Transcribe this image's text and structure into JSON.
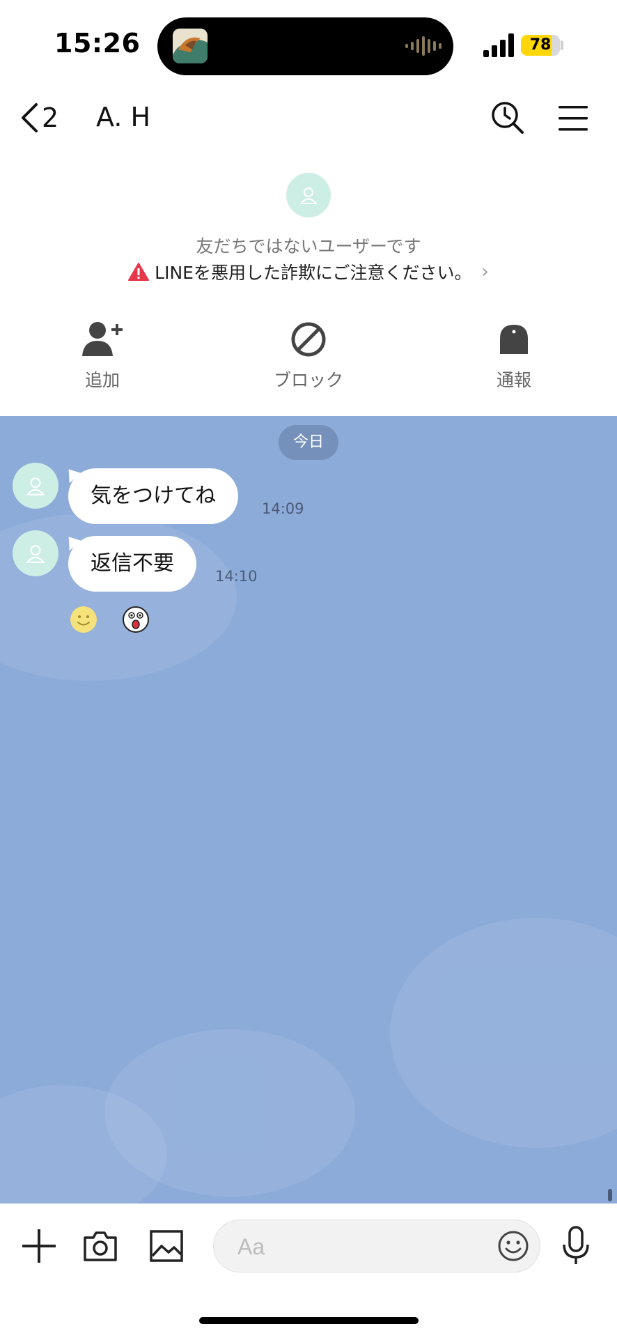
{
  "status_bar": {
    "time": "15:26",
    "battery_percent": "78",
    "battery_level": 0.78,
    "battery_color": "#ffd60a"
  },
  "header": {
    "back_count": "2",
    "title": "A. H",
    "icons": [
      "chevron-left-icon",
      "search-history-icon",
      "hamburger-menu-icon"
    ]
  },
  "profile_notice": {
    "not_friend_text": "友だちではないユーザーです",
    "warning_text": "LINEを悪用した詐欺にご注意ください。",
    "warning_color": "#e5384a"
  },
  "actions": [
    {
      "label": "追加",
      "icon": "add-friend-icon"
    },
    {
      "label": "ブロック",
      "icon": "block-icon"
    },
    {
      "label": "通報",
      "icon": "report-icon"
    }
  ],
  "chat": {
    "background_color": "#8cabd9",
    "date_label": "今日",
    "messages": [
      {
        "text": "気をつけてね",
        "time": "14:09"
      },
      {
        "text": "返信不要",
        "time": "14:10"
      }
    ],
    "reactions": [
      "smile-reaction-icon",
      "surprised-reaction-icon"
    ]
  },
  "input_bar": {
    "placeholder": "Aa",
    "icons": [
      "plus-icon",
      "camera-icon",
      "image-icon",
      "emoji-icon",
      "microphone-icon"
    ]
  }
}
